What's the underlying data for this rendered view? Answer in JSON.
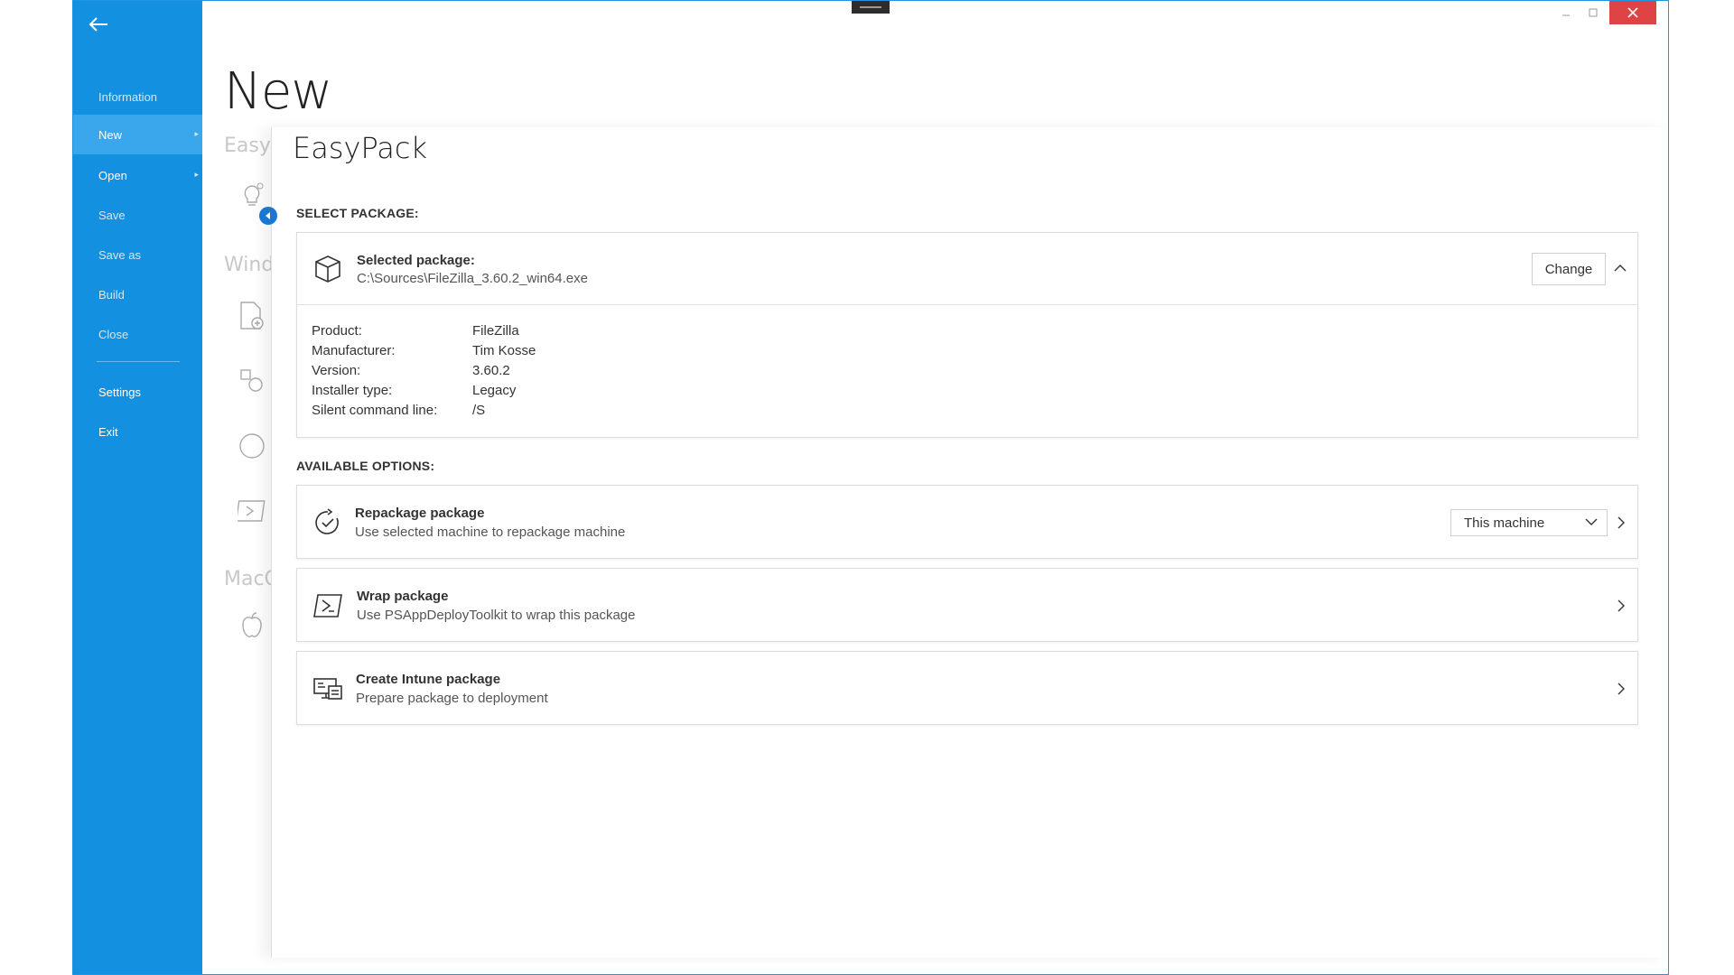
{
  "window": {
    "controls": {
      "minimize": "minimize",
      "maximize": "maximize",
      "close": "close"
    }
  },
  "sidebar": {
    "items": [
      {
        "label": "Information"
      },
      {
        "label": "New"
      },
      {
        "label": "Open"
      },
      {
        "label": "Save"
      },
      {
        "label": "Save as"
      },
      {
        "label": "Build"
      },
      {
        "label": "Close"
      },
      {
        "label": "Settings"
      },
      {
        "label": "Exit"
      }
    ]
  },
  "page": {
    "title": "New"
  },
  "categories": [
    {
      "label": "EasyPack"
    },
    {
      "label": "Windows"
    },
    {
      "label": "MacOS"
    }
  ],
  "panel": {
    "title": "EasyPack",
    "select_section": "SELECT PACKAGE:",
    "selected": {
      "title": "Selected package:",
      "path": "C:\\Sources\\FileZilla_3.60.2_win64.exe",
      "change_label": "Change"
    },
    "details": [
      {
        "label": "Product:",
        "value": "FileZilla"
      },
      {
        "label": "Manufacturer:",
        "value": "Tim Kosse"
      },
      {
        "label": "Version:",
        "value": "3.60.2"
      },
      {
        "label": "Installer type:",
        "value": "Legacy"
      },
      {
        "label": "Silent command line:",
        "value": "/S"
      }
    ],
    "options_section": "AVAILABLE OPTIONS:",
    "options": [
      {
        "title": "Repackage package",
        "subtitle": "Use selected machine to repackage machine",
        "dropdown": "This machine"
      },
      {
        "title": "Wrap package",
        "subtitle": "Use PSAppDeployToolkit to wrap this package"
      },
      {
        "title": "Create Intune package",
        "subtitle": "Prepare package to deployment"
      }
    ]
  },
  "colors": {
    "sidebar": "#1391e0",
    "sidebar_active": "#3aa7ec",
    "close_button": "#e04343",
    "accent": "#1877d2"
  }
}
